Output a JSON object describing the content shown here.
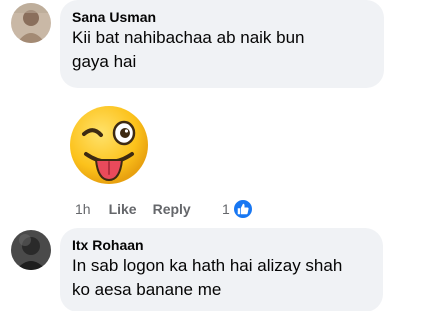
{
  "comments": [
    {
      "author": "Sana Usman",
      "text_line1": "Kii bat nahibachaa ab naik bun",
      "text_line2": "gaya hai",
      "time": "1h",
      "like_label": "Like",
      "reply_label": "Reply",
      "reaction_count": "1",
      "reaction_icon": "thumbs-up-icon",
      "sticker": "winking-face-with-tongue-emoji"
    },
    {
      "author": "Itx Rohaan",
      "text_line1": "In sab logon ka hath hai alizay shah",
      "text_line2": "ko aesa banane me"
    }
  ],
  "colors": {
    "bubble": "#f0f2f5",
    "meta_text": "#65676b",
    "like_blue": "#1877f2",
    "emoji_yellow": "#fcc21b"
  }
}
